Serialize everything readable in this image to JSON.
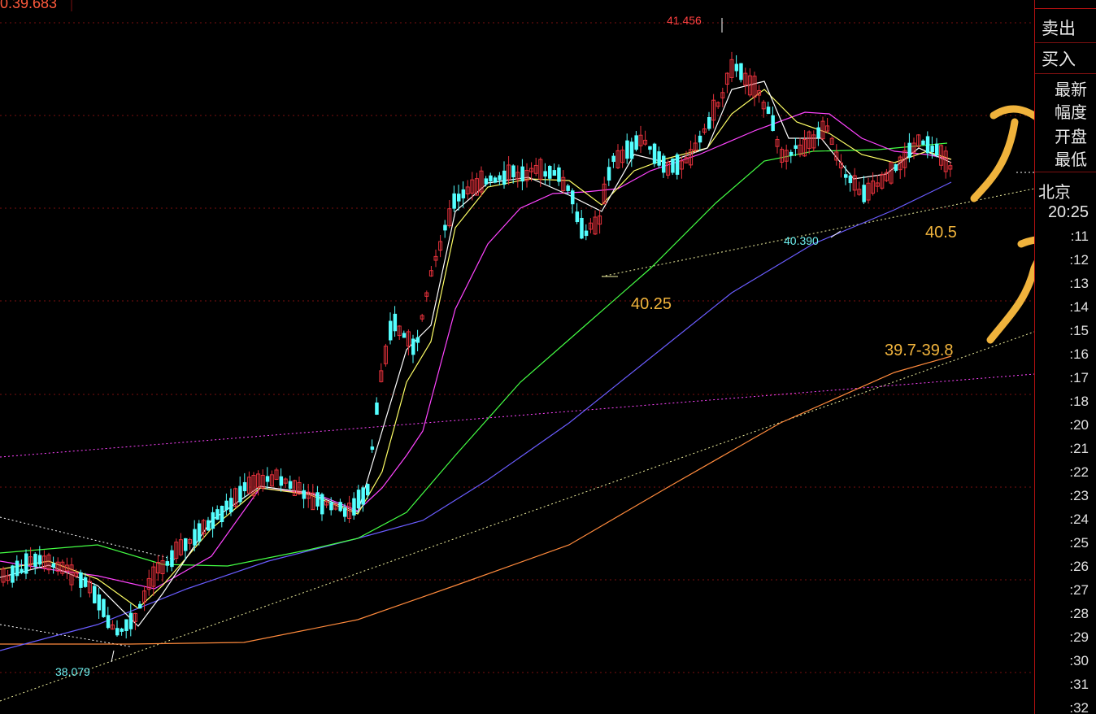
{
  "chart": {
    "top_price_label": "0.39.683",
    "high_label": "41.456",
    "low_label_left": "38.079",
    "low_label_right": "40.390",
    "annotations": [
      "40.25",
      "40.5",
      "39.7-39.8"
    ],
    "colors": {
      "up": "#e8323c",
      "down": "#54ffff",
      "ma5": "#ffffff",
      "ma10": "#ffff66",
      "ma20": "#ff44ff",
      "ma60": "#44ff44",
      "ma120": "#6a5cff",
      "ma250": "#ff8a3c",
      "annotation": "#f0b33c",
      "grid": "#7a1010"
    }
  },
  "panel": {
    "sell_label": "卖出",
    "buy_label": "买入",
    "info_labels": [
      "最新",
      "幅度",
      "开盘",
      "最低"
    ],
    "city": "北京",
    "time": "20:25",
    "ticks": [
      ":11",
      ":12",
      ":13",
      ":14",
      ":15",
      ":16",
      ":17",
      ":18",
      ":20",
      ":21",
      ":22",
      ":23",
      ":24",
      ":25",
      ":26",
      ":27",
      ":28",
      ":29",
      ":30",
      ":31",
      ":32"
    ]
  }
}
